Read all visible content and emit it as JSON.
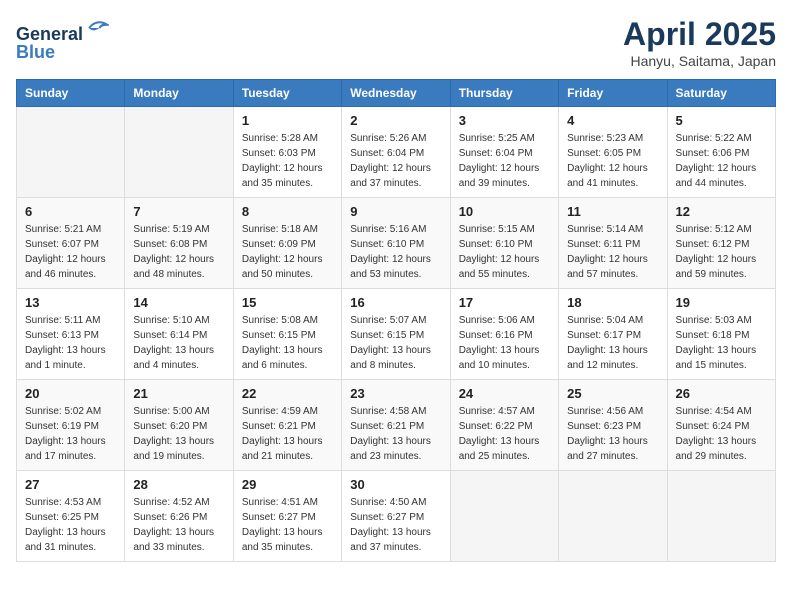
{
  "header": {
    "logo_line1": "General",
    "logo_line2": "Blue",
    "title": "April 2025",
    "location": "Hanyu, Saitama, Japan"
  },
  "days_of_week": [
    "Sunday",
    "Monday",
    "Tuesday",
    "Wednesday",
    "Thursday",
    "Friday",
    "Saturday"
  ],
  "weeks": [
    [
      {
        "day": "",
        "info": ""
      },
      {
        "day": "",
        "info": ""
      },
      {
        "day": "1",
        "info": "Sunrise: 5:28 AM\nSunset: 6:03 PM\nDaylight: 12 hours\nand 35 minutes."
      },
      {
        "day": "2",
        "info": "Sunrise: 5:26 AM\nSunset: 6:04 PM\nDaylight: 12 hours\nand 37 minutes."
      },
      {
        "day": "3",
        "info": "Sunrise: 5:25 AM\nSunset: 6:04 PM\nDaylight: 12 hours\nand 39 minutes."
      },
      {
        "day": "4",
        "info": "Sunrise: 5:23 AM\nSunset: 6:05 PM\nDaylight: 12 hours\nand 41 minutes."
      },
      {
        "day": "5",
        "info": "Sunrise: 5:22 AM\nSunset: 6:06 PM\nDaylight: 12 hours\nand 44 minutes."
      }
    ],
    [
      {
        "day": "6",
        "info": "Sunrise: 5:21 AM\nSunset: 6:07 PM\nDaylight: 12 hours\nand 46 minutes."
      },
      {
        "day": "7",
        "info": "Sunrise: 5:19 AM\nSunset: 6:08 PM\nDaylight: 12 hours\nand 48 minutes."
      },
      {
        "day": "8",
        "info": "Sunrise: 5:18 AM\nSunset: 6:09 PM\nDaylight: 12 hours\nand 50 minutes."
      },
      {
        "day": "9",
        "info": "Sunrise: 5:16 AM\nSunset: 6:10 PM\nDaylight: 12 hours\nand 53 minutes."
      },
      {
        "day": "10",
        "info": "Sunrise: 5:15 AM\nSunset: 6:10 PM\nDaylight: 12 hours\nand 55 minutes."
      },
      {
        "day": "11",
        "info": "Sunrise: 5:14 AM\nSunset: 6:11 PM\nDaylight: 12 hours\nand 57 minutes."
      },
      {
        "day": "12",
        "info": "Sunrise: 5:12 AM\nSunset: 6:12 PM\nDaylight: 12 hours\nand 59 minutes."
      }
    ],
    [
      {
        "day": "13",
        "info": "Sunrise: 5:11 AM\nSunset: 6:13 PM\nDaylight: 13 hours\nand 1 minute."
      },
      {
        "day": "14",
        "info": "Sunrise: 5:10 AM\nSunset: 6:14 PM\nDaylight: 13 hours\nand 4 minutes."
      },
      {
        "day": "15",
        "info": "Sunrise: 5:08 AM\nSunset: 6:15 PM\nDaylight: 13 hours\nand 6 minutes."
      },
      {
        "day": "16",
        "info": "Sunrise: 5:07 AM\nSunset: 6:15 PM\nDaylight: 13 hours\nand 8 minutes."
      },
      {
        "day": "17",
        "info": "Sunrise: 5:06 AM\nSunset: 6:16 PM\nDaylight: 13 hours\nand 10 minutes."
      },
      {
        "day": "18",
        "info": "Sunrise: 5:04 AM\nSunset: 6:17 PM\nDaylight: 13 hours\nand 12 minutes."
      },
      {
        "day": "19",
        "info": "Sunrise: 5:03 AM\nSunset: 6:18 PM\nDaylight: 13 hours\nand 15 minutes."
      }
    ],
    [
      {
        "day": "20",
        "info": "Sunrise: 5:02 AM\nSunset: 6:19 PM\nDaylight: 13 hours\nand 17 minutes."
      },
      {
        "day": "21",
        "info": "Sunrise: 5:00 AM\nSunset: 6:20 PM\nDaylight: 13 hours\nand 19 minutes."
      },
      {
        "day": "22",
        "info": "Sunrise: 4:59 AM\nSunset: 6:21 PM\nDaylight: 13 hours\nand 21 minutes."
      },
      {
        "day": "23",
        "info": "Sunrise: 4:58 AM\nSunset: 6:21 PM\nDaylight: 13 hours\nand 23 minutes."
      },
      {
        "day": "24",
        "info": "Sunrise: 4:57 AM\nSunset: 6:22 PM\nDaylight: 13 hours\nand 25 minutes."
      },
      {
        "day": "25",
        "info": "Sunrise: 4:56 AM\nSunset: 6:23 PM\nDaylight: 13 hours\nand 27 minutes."
      },
      {
        "day": "26",
        "info": "Sunrise: 4:54 AM\nSunset: 6:24 PM\nDaylight: 13 hours\nand 29 minutes."
      }
    ],
    [
      {
        "day": "27",
        "info": "Sunrise: 4:53 AM\nSunset: 6:25 PM\nDaylight: 13 hours\nand 31 minutes."
      },
      {
        "day": "28",
        "info": "Sunrise: 4:52 AM\nSunset: 6:26 PM\nDaylight: 13 hours\nand 33 minutes."
      },
      {
        "day": "29",
        "info": "Sunrise: 4:51 AM\nSunset: 6:27 PM\nDaylight: 13 hours\nand 35 minutes."
      },
      {
        "day": "30",
        "info": "Sunrise: 4:50 AM\nSunset: 6:27 PM\nDaylight: 13 hours\nand 37 minutes."
      },
      {
        "day": "",
        "info": ""
      },
      {
        "day": "",
        "info": ""
      },
      {
        "day": "",
        "info": ""
      }
    ]
  ]
}
